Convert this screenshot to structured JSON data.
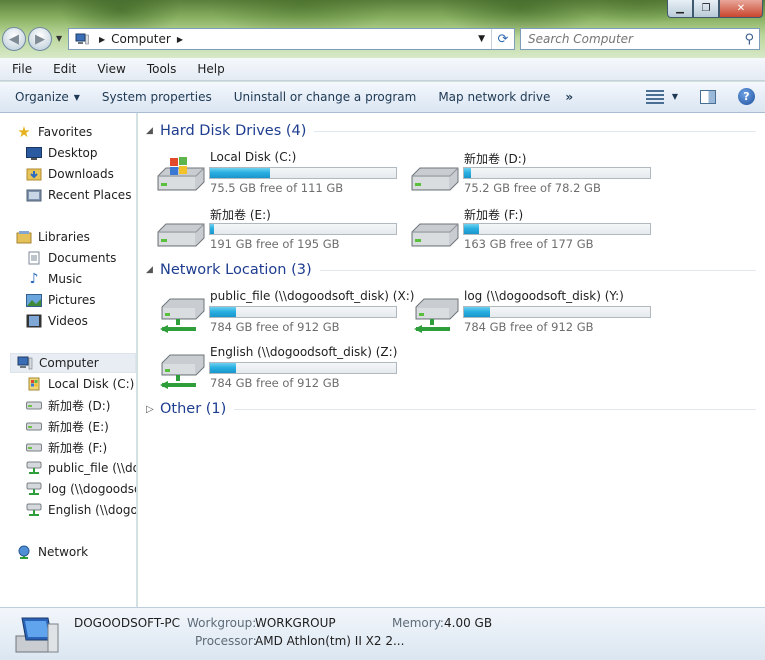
{
  "window": {
    "caption_buttons": [
      "minimize",
      "maximize",
      "close"
    ],
    "address": {
      "crumb": "Computer"
    },
    "search": {
      "placeholder": "Search Computer"
    }
  },
  "menubar": [
    "File",
    "Edit",
    "View",
    "Tools",
    "Help"
  ],
  "commands": {
    "organize": "Organize",
    "system_properties": "System properties",
    "uninstall": "Uninstall or change a program",
    "map_drive": "Map network drive",
    "more": "»"
  },
  "nav": {
    "favorites": "Favorites",
    "desktop": "Desktop",
    "downloads": "Downloads",
    "recent": "Recent Places",
    "libraries": "Libraries",
    "documents": "Documents",
    "music": "Music",
    "pictures": "Pictures",
    "videos": "Videos",
    "computer": "Computer",
    "local_c": "Local Disk (C:)",
    "vol_d": "新加卷 (D:)",
    "vol_e": "新加卷 (E:)",
    "vol_f": "新加卷 (F:)",
    "net_x": "public_file (\\\\dogoodsoft_disk) (X:)",
    "net_y": "log (\\\\dogoodsoft_disk) (Y:)",
    "net_z": "English (\\\\dogoodsoft_disk) (Z:)",
    "network": "Network"
  },
  "groups": {
    "hdd": "Hard Disk Drives (4)",
    "netloc": "Network Location (3)",
    "other": "Other (1)"
  },
  "drives": [
    {
      "name": "Local Disk (C:)",
      "free": "75.5 GB free of 111 GB",
      "used_fraction": 0.32,
      "icon": "windows-drive-icon"
    },
    {
      "name": "新加卷 (D:)",
      "free": "75.2 GB free of 78.2 GB",
      "used_fraction": 0.04,
      "icon": "hard-drive-icon"
    },
    {
      "name": "新加卷 (E:)",
      "free": "191 GB free of 195 GB",
      "used_fraction": 0.02,
      "icon": "hard-drive-icon"
    },
    {
      "name": "新加卷 (F:)",
      "free": "163 GB free of 177 GB",
      "used_fraction": 0.08,
      "icon": "hard-drive-icon"
    }
  ],
  "network_drives": [
    {
      "name": "public_file (\\\\dogoodsoft_disk) (X:)",
      "free": "784 GB free of 912 GB",
      "used_fraction": 0.14,
      "icon": "network-drive-icon"
    },
    {
      "name": "log (\\\\dogoodsoft_disk) (Y:)",
      "free": "784 GB free of 912 GB",
      "used_fraction": 0.14,
      "icon": "network-drive-icon"
    },
    {
      "name": "English (\\\\dogoodsoft_disk) (Z:)",
      "free": "784 GB free of 912 GB",
      "used_fraction": 0.14,
      "icon": "network-drive-icon"
    }
  ],
  "details": {
    "pc_name": "DOGOODSOFT-PC",
    "workgroup_label": "Workgroup:",
    "workgroup": "WORKGROUP",
    "memory_label": "Memory:",
    "memory": "4.00 GB",
    "processor_label": "Processor:",
    "processor": "AMD Athlon(tm) II X2 2..."
  }
}
